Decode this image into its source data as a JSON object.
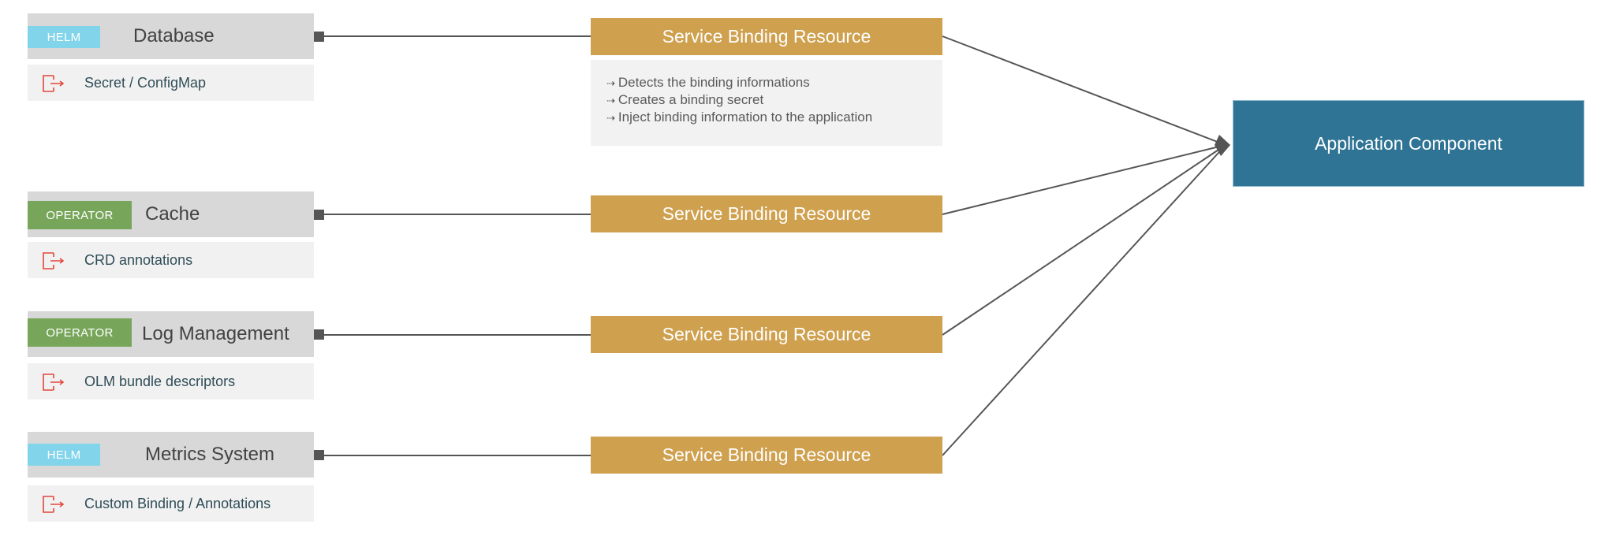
{
  "services": [
    {
      "badge": "HELM",
      "badge_type": "helm",
      "name": "Database",
      "source": "Secret / ConfigMap"
    },
    {
      "badge": "OPERATOR",
      "badge_type": "operator",
      "name": "Cache",
      "source": "CRD annotations"
    },
    {
      "badge": "OPERATOR",
      "badge_type": "operator",
      "name": "Log Management",
      "source": "OLM bundle descriptors"
    },
    {
      "badge": "HELM",
      "badge_type": "helm",
      "name": "Metrics System",
      "source": "Custom Binding / Annotations"
    }
  ],
  "binding_resources": [
    {
      "label": "Service Binding Resource"
    },
    {
      "label": "Service Binding Resource"
    },
    {
      "label": "Service Binding Resource"
    },
    {
      "label": "Service Binding Resource"
    }
  ],
  "binding_description": {
    "bullet": "⇢",
    "items": [
      "Detects the binding informations",
      "Creates a binding secret",
      "Inject binding information to the application"
    ]
  },
  "application": {
    "label": "Application Component"
  },
  "colors": {
    "helm": "#82d4ea",
    "operator": "#77a65a",
    "binding": "#cfa04e",
    "application": "#2f7494",
    "source_icon": "#e2473b",
    "line": "#555555"
  }
}
